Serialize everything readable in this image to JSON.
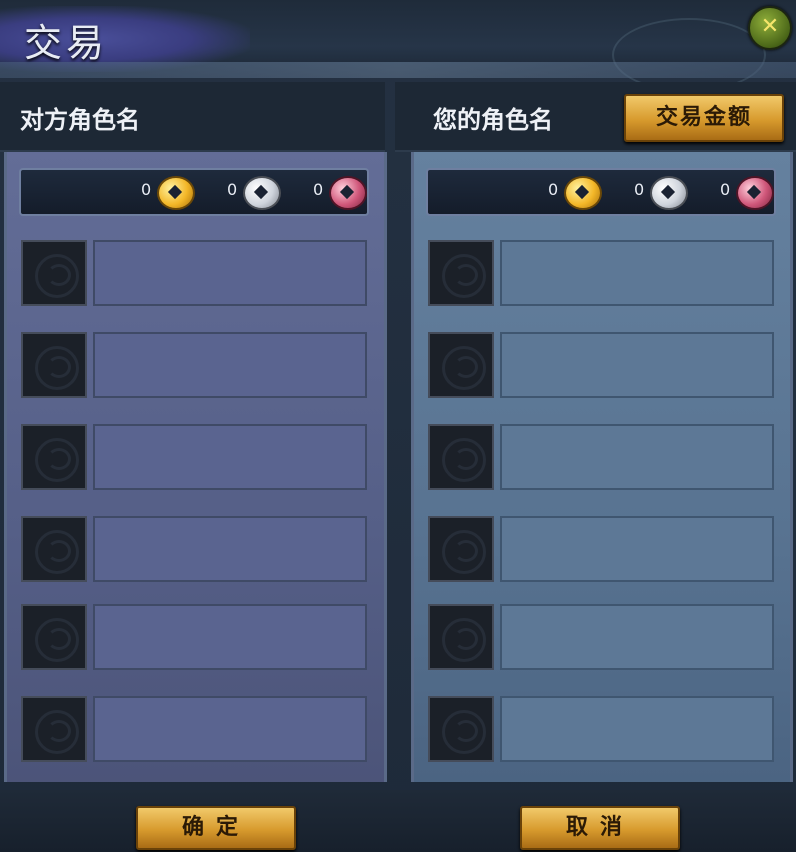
{
  "window": {
    "title": "交易",
    "close_glyph": "✕"
  },
  "left_panel": {
    "role_name": "对方角色名",
    "money": {
      "gold": "0",
      "silver": "0",
      "copper": "0"
    },
    "slots": [
      {},
      {},
      {},
      {},
      {},
      {}
    ]
  },
  "right_panel": {
    "role_name": "您的角色名",
    "gold_button_label": "交易金额",
    "money": {
      "gold": "0",
      "silver": "0",
      "copper": "0"
    },
    "slots": [
      {},
      {},
      {},
      {},
      {},
      {}
    ]
  },
  "footer": {
    "confirm_label": "确定",
    "cancel_label": "取消"
  },
  "icons": {
    "gold_coin": "gold-coin-icon",
    "silver_coin": "silver-coin-icon",
    "copper_coin": "copper-coin-icon",
    "close": "close-icon"
  }
}
